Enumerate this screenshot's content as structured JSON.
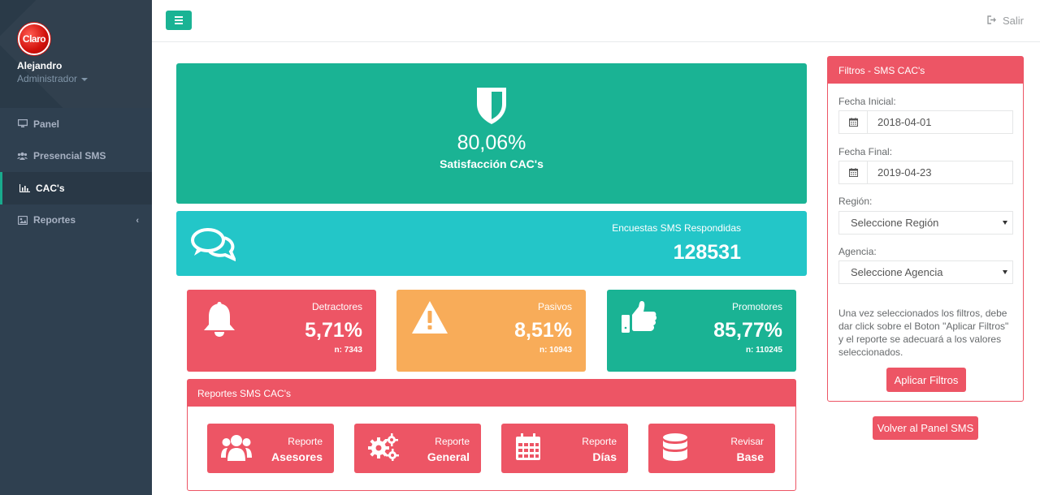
{
  "colors": {
    "sidebar_bg": "#2f4050",
    "accent_green": "#1ab394",
    "accent_cyan": "#23c6c8",
    "accent_red": "#ed5565",
    "accent_yellow": "#f8ac59"
  },
  "profile": {
    "logo_text": "Claro",
    "name": "Alejandro",
    "role": "Administrador"
  },
  "nav": {
    "items": [
      {
        "label": "Panel",
        "icon": "desktop-icon"
      },
      {
        "label": "Presencial SMS",
        "icon": "users-icon"
      },
      {
        "label": "CAC's",
        "icon": "bar-chart-icon"
      },
      {
        "label": "Reportes",
        "icon": "picture-icon"
      }
    ]
  },
  "topbar": {
    "logout_label": "Salir"
  },
  "satisfaction": {
    "value": "80,06%",
    "label": "Satisfacción CAC's"
  },
  "surveys": {
    "label": "Encuestas SMS Respondidas",
    "value": "128531"
  },
  "stats": {
    "detractores": {
      "label": "Detractores",
      "value": "5,71%",
      "n": "n: 7343"
    },
    "pasivos": {
      "label": "Pasivos",
      "value": "8,51%",
      "n": "n: 10943"
    },
    "promotores": {
      "label": "Promotores",
      "value": "85,77%",
      "n": "n: 110245"
    }
  },
  "reports": {
    "title": "Reportes SMS CAC's",
    "buttons": [
      {
        "line1": "Reporte",
        "line2": "Asesores"
      },
      {
        "line1": "Reporte",
        "line2": "General"
      },
      {
        "line1": "Reporte",
        "line2": "Días"
      },
      {
        "line1": "Revisar",
        "line2": "Base"
      }
    ]
  },
  "filters": {
    "title": "Filtros - SMS CAC's",
    "start_label": "Fecha Inicial:",
    "start_value": "2018-04-01",
    "end_label": "Fecha Final:",
    "end_value": "2019-04-23",
    "region_label": "Región:",
    "region_value": "Seleccione Región",
    "agency_label": "Agencia:",
    "agency_value": "Seleccione Agencia",
    "help_text": "Una vez seleccionados los filtros, debe dar click sobre el Boton \"Aplicar Filtros\" y el reporte se adecuará a los valores seleccionados.",
    "apply_label": "Aplicar Filtros"
  },
  "back_button": "Volver al Panel SMS"
}
